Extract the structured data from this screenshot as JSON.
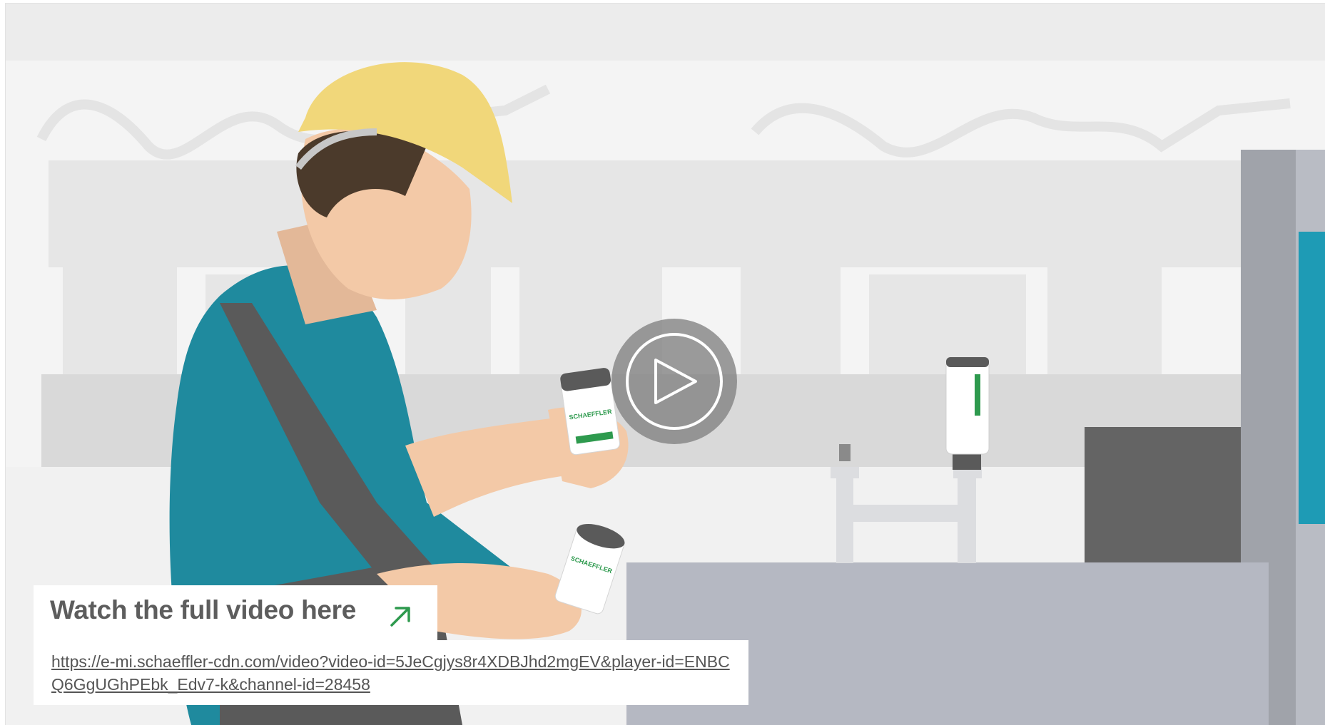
{
  "video": {
    "play_icon": "play-icon",
    "background": "animated-scene-factory-worker"
  },
  "cta": {
    "title": "Watch the full video here",
    "arrow_icon": "arrow-up-right-icon",
    "arrow_color": "#2e9a4e"
  },
  "link": {
    "url": "https://e-mi.schaeffler-cdn.com/video?video-id=5JeCgjys8r4XDBJhd2mgEV&player-id=ENBCQ6GgUGhPEbk_Edv7-k&channel-id=28458"
  },
  "product": {
    "brand": "SCHAEFFLER"
  },
  "colors": {
    "helmet": "#f1d77a",
    "shirt": "#1f8a9e",
    "overalls": "#5a5a5a",
    "skin": "#f3c9a7",
    "machine": "#b5b8c2",
    "accent_green": "#2e9a4e"
  }
}
